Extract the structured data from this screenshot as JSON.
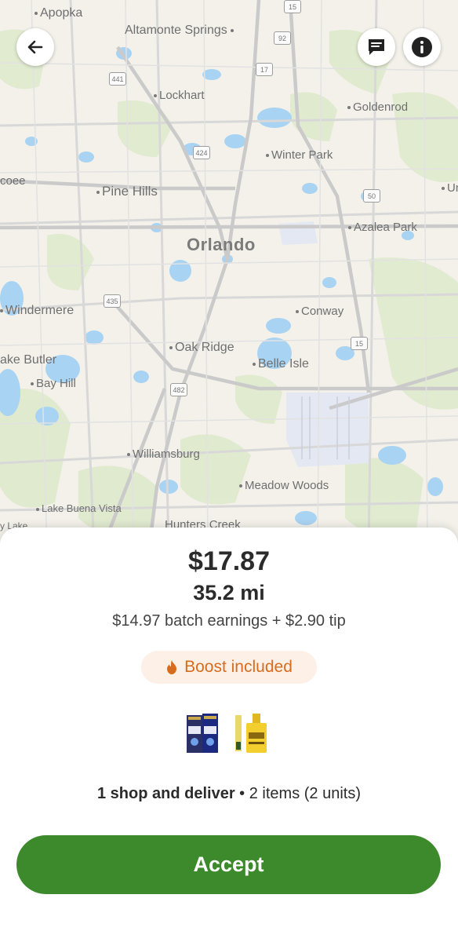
{
  "map": {
    "places": {
      "apopka": "Apopka",
      "altamonte": "Altamonte Springs",
      "lockhart": "Lockhart",
      "goldenrod": "Goldenrod",
      "winter_park": "Winter Park",
      "ocoee": "coee",
      "pine_hills": "Pine Hills",
      "un": "Un",
      "azalea_park": "Azalea Park",
      "orlando": "Orlando",
      "windermere": "Windermere",
      "conway": "Conway",
      "oak_ridge": "Oak Ridge",
      "lake_butler": "ake Butler",
      "belle_isle": "Belle Isle",
      "bay_hill": "Bay Hill",
      "williamsburg": "Williamsburg",
      "meadow_woods": "Meadow Woods",
      "lake_buena_vista": "Lake Buena Vista",
      "hunters_creek": "Hunters Creek",
      "lake": "y Lake"
    },
    "shields": {
      "s15_top": "15",
      "s92": "92",
      "s441": "441",
      "s17": "17",
      "s424": "424",
      "s50": "50",
      "s435": "435",
      "s15_mid": "15",
      "s482": "482"
    }
  },
  "header": {
    "back_icon": "arrow-left-icon",
    "chat_icon": "chat-icon",
    "info_icon": "info-icon"
  },
  "offer": {
    "price": "$17.87",
    "distance": "35.2 mi",
    "earnings": "$14.97 batch earnings + $2.90 tip",
    "boost_label": "Boost included",
    "boost_color": "#d86c1e",
    "summary_bold": "1 shop and deliver",
    "summary_sep": " • ",
    "summary_rest": "2 items (2 units)",
    "accept_label": "Accept",
    "accent": "#3d8a2d"
  }
}
